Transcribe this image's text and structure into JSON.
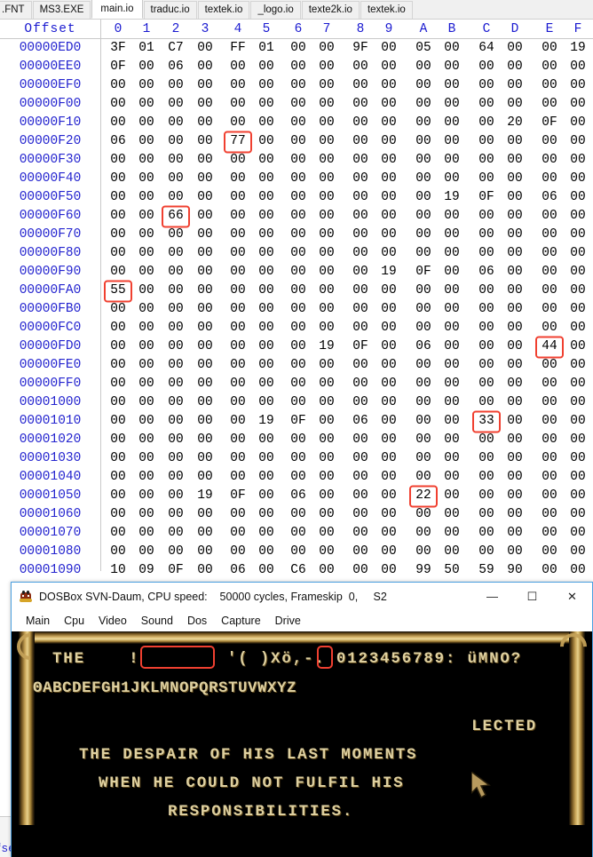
{
  "hex_editor": {
    "tabs": [
      {
        "label": ".FNT",
        "active": false
      },
      {
        "label": "MS3.EXE",
        "active": false
      },
      {
        "label": "main.io",
        "active": true
      },
      {
        "label": "traduc.io",
        "active": false
      },
      {
        "label": "textek.io",
        "active": false
      },
      {
        "label": "_logo.io",
        "active": false
      },
      {
        "label": "texte2k.io",
        "active": false
      },
      {
        "label": "textek.io",
        "active": false
      }
    ],
    "offset_header": "Offset",
    "column_headers": [
      "0",
      "1",
      "2",
      "3",
      "4",
      "5",
      "6",
      "7",
      "8",
      "9",
      "A",
      "B",
      "C",
      "D",
      "E",
      "F"
    ],
    "status_text": "Offset:",
    "highlight_color": "#f04030",
    "offset_color": "#2424cf",
    "rows": [
      {
        "offset": "00000ED0",
        "bytes": [
          "3F",
          "01",
          "C7",
          "00",
          "FF",
          "01",
          "00",
          "00",
          "9F",
          "00",
          "05",
          "00",
          "64",
          "00",
          "00",
          "19"
        ],
        "highlight": -1
      },
      {
        "offset": "00000EE0",
        "bytes": [
          "0F",
          "00",
          "06",
          "00",
          "00",
          "00",
          "00",
          "00",
          "00",
          "00",
          "00",
          "00",
          "00",
          "00",
          "00",
          "00"
        ],
        "highlight": -1
      },
      {
        "offset": "00000EF0",
        "bytes": [
          "00",
          "00",
          "00",
          "00",
          "00",
          "00",
          "00",
          "00",
          "00",
          "00",
          "00",
          "00",
          "00",
          "00",
          "00",
          "00"
        ],
        "highlight": -1
      },
      {
        "offset": "00000F00",
        "bytes": [
          "00",
          "00",
          "00",
          "00",
          "00",
          "00",
          "00",
          "00",
          "00",
          "00",
          "00",
          "00",
          "00",
          "00",
          "00",
          "00"
        ],
        "highlight": -1
      },
      {
        "offset": "00000F10",
        "bytes": [
          "00",
          "00",
          "00",
          "00",
          "00",
          "00",
          "00",
          "00",
          "00",
          "00",
          "00",
          "00",
          "00",
          "20",
          "0F",
          "00"
        ],
        "highlight": -1
      },
      {
        "offset": "00000F20",
        "bytes": [
          "06",
          "00",
          "00",
          "00",
          "77",
          "00",
          "00",
          "00",
          "00",
          "00",
          "00",
          "00",
          "00",
          "00",
          "00",
          "00"
        ],
        "highlight": 4
      },
      {
        "offset": "00000F30",
        "bytes": [
          "00",
          "00",
          "00",
          "00",
          "00",
          "00",
          "00",
          "00",
          "00",
          "00",
          "00",
          "00",
          "00",
          "00",
          "00",
          "00"
        ],
        "highlight": -1
      },
      {
        "offset": "00000F40",
        "bytes": [
          "00",
          "00",
          "00",
          "00",
          "00",
          "00",
          "00",
          "00",
          "00",
          "00",
          "00",
          "00",
          "00",
          "00",
          "00",
          "00"
        ],
        "highlight": -1
      },
      {
        "offset": "00000F50",
        "bytes": [
          "00",
          "00",
          "00",
          "00",
          "00",
          "00",
          "00",
          "00",
          "00",
          "00",
          "00",
          "19",
          "0F",
          "00",
          "06",
          "00"
        ],
        "highlight": -1
      },
      {
        "offset": "00000F60",
        "bytes": [
          "00",
          "00",
          "66",
          "00",
          "00",
          "00",
          "00",
          "00",
          "00",
          "00",
          "00",
          "00",
          "00",
          "00",
          "00",
          "00"
        ],
        "highlight": 2
      },
      {
        "offset": "00000F70",
        "bytes": [
          "00",
          "00",
          "00",
          "00",
          "00",
          "00",
          "00",
          "00",
          "00",
          "00",
          "00",
          "00",
          "00",
          "00",
          "00",
          "00"
        ],
        "highlight": -1
      },
      {
        "offset": "00000F80",
        "bytes": [
          "00",
          "00",
          "00",
          "00",
          "00",
          "00",
          "00",
          "00",
          "00",
          "00",
          "00",
          "00",
          "00",
          "00",
          "00",
          "00"
        ],
        "highlight": -1
      },
      {
        "offset": "00000F90",
        "bytes": [
          "00",
          "00",
          "00",
          "00",
          "00",
          "00",
          "00",
          "00",
          "00",
          "19",
          "0F",
          "00",
          "06",
          "00",
          "00",
          "00"
        ],
        "highlight": -1
      },
      {
        "offset": "00000FA0",
        "bytes": [
          "55",
          "00",
          "00",
          "00",
          "00",
          "00",
          "00",
          "00",
          "00",
          "00",
          "00",
          "00",
          "00",
          "00",
          "00",
          "00"
        ],
        "highlight": 0
      },
      {
        "offset": "00000FB0",
        "bytes": [
          "00",
          "00",
          "00",
          "00",
          "00",
          "00",
          "00",
          "00",
          "00",
          "00",
          "00",
          "00",
          "00",
          "00",
          "00",
          "00"
        ],
        "highlight": -1
      },
      {
        "offset": "00000FC0",
        "bytes": [
          "00",
          "00",
          "00",
          "00",
          "00",
          "00",
          "00",
          "00",
          "00",
          "00",
          "00",
          "00",
          "00",
          "00",
          "00",
          "00"
        ],
        "highlight": -1
      },
      {
        "offset": "00000FD0",
        "bytes": [
          "00",
          "00",
          "00",
          "00",
          "00",
          "00",
          "00",
          "19",
          "0F",
          "00",
          "06",
          "00",
          "00",
          "00",
          "44",
          "00"
        ],
        "highlight": 14
      },
      {
        "offset": "00000FE0",
        "bytes": [
          "00",
          "00",
          "00",
          "00",
          "00",
          "00",
          "00",
          "00",
          "00",
          "00",
          "00",
          "00",
          "00",
          "00",
          "00",
          "00"
        ],
        "highlight": -1
      },
      {
        "offset": "00000FF0",
        "bytes": [
          "00",
          "00",
          "00",
          "00",
          "00",
          "00",
          "00",
          "00",
          "00",
          "00",
          "00",
          "00",
          "00",
          "00",
          "00",
          "00"
        ],
        "highlight": -1
      },
      {
        "offset": "00001000",
        "bytes": [
          "00",
          "00",
          "00",
          "00",
          "00",
          "00",
          "00",
          "00",
          "00",
          "00",
          "00",
          "00",
          "00",
          "00",
          "00",
          "00"
        ],
        "highlight": -1
      },
      {
        "offset": "00001010",
        "bytes": [
          "00",
          "00",
          "00",
          "00",
          "00",
          "19",
          "0F",
          "00",
          "06",
          "00",
          "00",
          "00",
          "33",
          "00",
          "00",
          "00"
        ],
        "highlight": 12
      },
      {
        "offset": "00001020",
        "bytes": [
          "00",
          "00",
          "00",
          "00",
          "00",
          "00",
          "00",
          "00",
          "00",
          "00",
          "00",
          "00",
          "00",
          "00",
          "00",
          "00"
        ],
        "highlight": -1
      },
      {
        "offset": "00001030",
        "bytes": [
          "00",
          "00",
          "00",
          "00",
          "00",
          "00",
          "00",
          "00",
          "00",
          "00",
          "00",
          "00",
          "00",
          "00",
          "00",
          "00"
        ],
        "highlight": -1
      },
      {
        "offset": "00001040",
        "bytes": [
          "00",
          "00",
          "00",
          "00",
          "00",
          "00",
          "00",
          "00",
          "00",
          "00",
          "00",
          "00",
          "00",
          "00",
          "00",
          "00"
        ],
        "highlight": -1
      },
      {
        "offset": "00001050",
        "bytes": [
          "00",
          "00",
          "00",
          "19",
          "0F",
          "00",
          "06",
          "00",
          "00",
          "00",
          "22",
          "00",
          "00",
          "00",
          "00",
          "00"
        ],
        "highlight": 10
      },
      {
        "offset": "00001060",
        "bytes": [
          "00",
          "00",
          "00",
          "00",
          "00",
          "00",
          "00",
          "00",
          "00",
          "00",
          "00",
          "00",
          "00",
          "00",
          "00",
          "00"
        ],
        "highlight": -1
      },
      {
        "offset": "00001070",
        "bytes": [
          "00",
          "00",
          "00",
          "00",
          "00",
          "00",
          "00",
          "00",
          "00",
          "00",
          "00",
          "00",
          "00",
          "00",
          "00",
          "00"
        ],
        "highlight": -1
      },
      {
        "offset": "00001080",
        "bytes": [
          "00",
          "00",
          "00",
          "00",
          "00",
          "00",
          "00",
          "00",
          "00",
          "00",
          "00",
          "00",
          "00",
          "00",
          "00",
          "00"
        ],
        "highlight": -1
      },
      {
        "offset": "00001090",
        "bytes": [
          "10",
          "09",
          "0F",
          "00",
          "06",
          "00",
          "C6",
          "00",
          "00",
          "00",
          "99",
          "50",
          "59",
          "90",
          "00",
          "00"
        ],
        "highlight": -1
      }
    ]
  },
  "dosbox": {
    "icon": "dosbox-icon",
    "title": "DOSBox SVN-Daum, CPU speed:    50000 cycles, Frameskip  0,     S2",
    "window_buttons": {
      "minimize": "—",
      "maximize": "☐",
      "close": "✕"
    },
    "menu": [
      "Main",
      "Cpu",
      "Video",
      "Sound",
      "Dos",
      "Capture",
      "Drive"
    ],
    "game": {
      "charset_line_1": "THE    !        '( )Xö,-. 0123456789: üMNO?",
      "charset_line_2": "ʘABCDEFGH1JKLMNOPQRSTUVWXYZ",
      "text_line_1": "LECTED",
      "text_line_2": "THE DESPAIR OF HIS LAST MOMENTS",
      "text_line_3": "WHEN HE COULD NOT FULFIL HIS",
      "text_line_4": "RESPONSIBILITIES.",
      "text_color": "#ded0a0",
      "background_color": "#000000",
      "border_color": "#c9a457",
      "cursor": "mouse-pointer-icon"
    }
  }
}
